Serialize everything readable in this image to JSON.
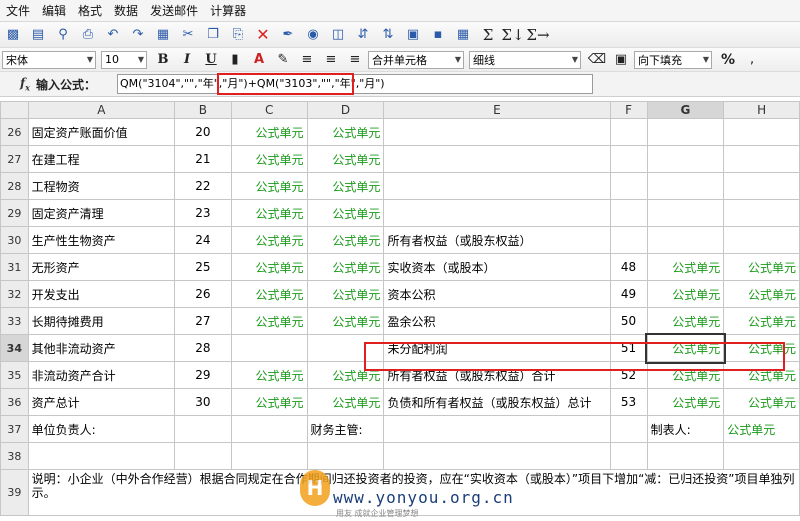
{
  "menu": [
    "文件",
    "编辑",
    "格式",
    "数据",
    "发送邮件",
    "计算器"
  ],
  "toolbar": {
    "font_family": "宋体",
    "font_size": "10",
    "merge_option": "合并单元格",
    "border_option": "细线",
    "fill_option": "向下填充",
    "percent_label": "%",
    "bold": "B",
    "italic": "I",
    "underline": "U"
  },
  "formula_bar": {
    "label": "输入公式：",
    "value": "QM(\"3104\",\"\",\"年\",\"月\")+QM(\"3103\",\"\",\"年\",\"月\")"
  },
  "columns": [
    "A",
    "B",
    "C",
    "D",
    "E",
    "F",
    "G",
    "H"
  ],
  "selected_column": "G",
  "selected_row": "34",
  "rows": [
    {
      "n": "26",
      "a": "固定资产账面价值",
      "b": "20",
      "c": "公式单元",
      "d": "公式单元",
      "e": "",
      "f": "",
      "g": "",
      "h": ""
    },
    {
      "n": "27",
      "a": "在建工程",
      "b": "21",
      "c": "公式单元",
      "d": "公式单元",
      "e": "",
      "f": "",
      "g": "",
      "h": ""
    },
    {
      "n": "28",
      "a": "工程物资",
      "b": "22",
      "c": "公式单元",
      "d": "公式单元",
      "e": "",
      "f": "",
      "g": "",
      "h": ""
    },
    {
      "n": "29",
      "a": "固定资产清理",
      "b": "23",
      "c": "公式单元",
      "d": "公式单元",
      "e": "",
      "f": "",
      "g": "",
      "h": ""
    },
    {
      "n": "30",
      "a": "生产性生物资产",
      "b": "24",
      "c": "公式单元",
      "d": "公式单元",
      "e": "所有者权益（或股东权益）",
      "f": "",
      "g": "",
      "h": ""
    },
    {
      "n": "31",
      "a": "无形资产",
      "b": "25",
      "c": "公式单元",
      "d": "公式单元",
      "e": "实收资本（或股本）",
      "f": "48",
      "g": "公式单元",
      "h": "公式单元"
    },
    {
      "n": "32",
      "a": "开发支出",
      "b": "26",
      "c": "公式单元",
      "d": "公式单元",
      "e": "资本公积",
      "f": "49",
      "g": "公式单元",
      "h": "公式单元"
    },
    {
      "n": "33",
      "a": "长期待摊费用",
      "b": "27",
      "c": "公式单元",
      "d": "公式单元",
      "e": "盈余公积",
      "f": "50",
      "g": "公式单元",
      "h": "公式单元"
    },
    {
      "n": "34",
      "a": "其他非流动资产",
      "b": "28",
      "c": "",
      "d": "",
      "e": "未分配利润",
      "f": "51",
      "g": "公式单元",
      "h": "公式单元"
    },
    {
      "n": "35",
      "a": "非流动资产合计",
      "b": "29",
      "c": "公式单元",
      "d": "公式单元",
      "e": "所有者权益（或股东权益）合计",
      "f": "52",
      "g": "公式单元",
      "h": "公式单元"
    },
    {
      "n": "36",
      "a": "资产总计",
      "b": "30",
      "c": "公式单元",
      "d": "公式单元",
      "e": "负债和所有者权益（或股东权益）总计",
      "f": "53",
      "g": "公式单元",
      "h": "公式单元"
    }
  ],
  "row37": {
    "n": "37",
    "unit_head": "单位负责人:",
    "finance_head": "财务主管:",
    "preparer": "制表人:",
    "preparer_value": "公式单元"
  },
  "row38": {
    "n": "38"
  },
  "row39": {
    "n": "39",
    "note": "说明：小企业（中外合作经营）根据合同规定在合作期间归还投资者的投资，应在“实收资本（或股本）”项目下增加“减：已归还投资”项目单独列示。"
  },
  "watermark": {
    "logo": "H",
    "text": "www.yonyou.org.cn",
    "sub": "用友 成就企业管理梦想"
  }
}
